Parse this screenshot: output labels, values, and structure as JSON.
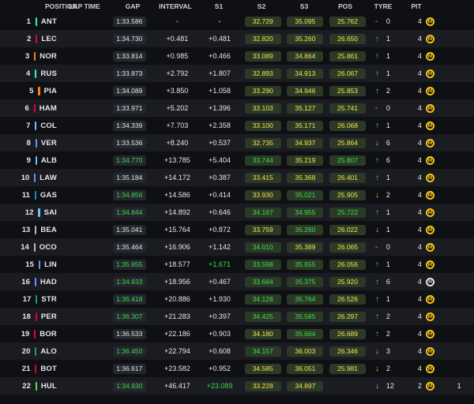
{
  "headers": {
    "position": "POSITION",
    "lap_time": "LAP TIME",
    "gap": "GAP",
    "interval": "INTERVAL",
    "s1": "S1",
    "s2": "S2",
    "s3": "S3",
    "pos": "POS",
    "tyre": "TYRE",
    "pit": "PIT"
  },
  "team_colors": {
    "mercedes": "#27f4d2",
    "ferrari": "#e8002d",
    "mclaren": "#ff8000",
    "redbull": "#3671c6",
    "williams": "#64c4ff",
    "alpine": "#0093cc",
    "racingbulls": "#6692ff",
    "haas": "#b6babd",
    "sauber": "#52e252",
    "astonmartin": "#229971"
  },
  "rows": [
    {
      "pos": "1",
      "code": "ANT",
      "team": "mercedes",
      "lap": "1:33.586",
      "lap_c": "white",
      "gap": "-",
      "int": "-",
      "int_c": "white",
      "s1": "32.729",
      "s1_c": "yellow",
      "s2": "35.095",
      "s2_c": "yellow",
      "s3": "25.762",
      "s3_c": "yellow",
      "chg": "none",
      "chg_n": "0",
      "tyre_age": "4",
      "tyre": "M",
      "pit": ""
    },
    {
      "pos": "2",
      "code": "LEC",
      "team": "ferrari",
      "lap": "1:34.730",
      "lap_c": "white",
      "gap": "+0.481",
      "int": "+0.481",
      "int_c": "white",
      "s1": "32.820",
      "s1_c": "yellow",
      "s2": "35.260",
      "s2_c": "yellow",
      "s3": "26.650",
      "s3_c": "yellow",
      "chg": "up",
      "chg_n": "1",
      "tyre_age": "4",
      "tyre": "M",
      "pit": ""
    },
    {
      "pos": "3",
      "code": "NOR",
      "team": "mclaren",
      "lap": "1:33.814",
      "lap_c": "white",
      "gap": "+0.985",
      "int": "+0.466",
      "int_c": "white",
      "s1": "33.089",
      "s1_c": "yellow",
      "s2": "34.864",
      "s2_c": "yellow",
      "s3": "25.861",
      "s3_c": "yellow",
      "chg": "up",
      "chg_n": "1",
      "tyre_age": "4",
      "tyre": "M",
      "pit": ""
    },
    {
      "pos": "4",
      "code": "RUS",
      "team": "mercedes",
      "lap": "1:33.873",
      "lap_c": "white",
      "gap": "+2.792",
      "int": "+1.807",
      "int_c": "white",
      "s1": "32.893",
      "s1_c": "yellow",
      "s2": "34.913",
      "s2_c": "yellow",
      "s3": "26.067",
      "s3_c": "yellow",
      "chg": "up",
      "chg_n": "1",
      "tyre_age": "4",
      "tyre": "M",
      "pit": ""
    },
    {
      "pos": "5",
      "code": "PIA",
      "team": "mclaren",
      "lap": "1:34.089",
      "lap_c": "white",
      "gap": "+3.850",
      "int": "+1.058",
      "int_c": "white",
      "s1": "33.290",
      "s1_c": "yellow",
      "s2": "34.946",
      "s2_c": "yellow",
      "s3": "25.853",
      "s3_c": "yellow",
      "chg": "up",
      "chg_n": "2",
      "tyre_age": "4",
      "tyre": "M",
      "pit": ""
    },
    {
      "pos": "6",
      "code": "HAM",
      "team": "ferrari",
      "lap": "1:33.971",
      "lap_c": "white",
      "gap": "+5.202",
      "int": "+1.396",
      "int_c": "white",
      "s1": "33.103",
      "s1_c": "yellow",
      "s2": "35.127",
      "s2_c": "yellow",
      "s3": "25.741",
      "s3_c": "yellow",
      "chg": "none",
      "chg_n": "0",
      "tyre_age": "4",
      "tyre": "M",
      "pit": ""
    },
    {
      "pos": "7",
      "code": "COL",
      "team": "williams",
      "lap": "1:34.339",
      "lap_c": "white",
      "gap": "+7.703",
      "int": "+2.358",
      "int_c": "white",
      "s1": "33.100",
      "s1_c": "yellow",
      "s2": "35.171",
      "s2_c": "yellow",
      "s3": "26.068",
      "s3_c": "yellow",
      "chg": "up",
      "chg_n": "1",
      "tyre_age": "4",
      "tyre": "M",
      "pit": ""
    },
    {
      "pos": "8",
      "code": "VER",
      "team": "racingbulls",
      "lap": "1:33.536",
      "lap_c": "white",
      "gap": "+8.240",
      "int": "+0.537",
      "int_c": "white",
      "s1": "32.735",
      "s1_c": "yellow",
      "s2": "34.937",
      "s2_c": "yellow",
      "s3": "25.864",
      "s3_c": "yellow",
      "chg": "down",
      "chg_n": "6",
      "tyre_age": "4",
      "tyre": "M",
      "pit": ""
    },
    {
      "pos": "9",
      "code": "ALB",
      "team": "williams",
      "lap": "1:34.770",
      "lap_c": "green",
      "gap": "+13.785",
      "int": "+5.404",
      "int_c": "white",
      "s1": "33.744",
      "s1_c": "green",
      "s2": "35.219",
      "s2_c": "yellow",
      "s3": "25.807",
      "s3_c": "green",
      "chg": "up",
      "chg_n": "6",
      "tyre_age": "4",
      "tyre": "M",
      "pit": ""
    },
    {
      "pos": "10",
      "code": "LAW",
      "team": "racingbulls",
      "lap": "1:35.184",
      "lap_c": "white",
      "gap": "+14.172",
      "int": "+0.387",
      "int_c": "white",
      "s1": "33.415",
      "s1_c": "yellow",
      "s2": "35.368",
      "s2_c": "yellow",
      "s3": "26.401",
      "s3_c": "yellow",
      "chg": "up",
      "chg_n": "1",
      "tyre_age": "4",
      "tyre": "M",
      "pit": ""
    },
    {
      "pos": "11",
      "code": "GAS",
      "team": "alpine",
      "lap": "1:34.856",
      "lap_c": "green",
      "gap": "+14.586",
      "int": "+0.414",
      "int_c": "white",
      "s1": "33.930",
      "s1_c": "yellow",
      "s2": "35.021",
      "s2_c": "green",
      "s3": "25.905",
      "s3_c": "yellow",
      "chg": "down",
      "chg_n": "2",
      "tyre_age": "4",
      "tyre": "M",
      "pit": ""
    },
    {
      "pos": "12",
      "code": "SAI",
      "team": "williams",
      "lap": "1:34.844",
      "lap_c": "green",
      "gap": "+14.892",
      "int": "+0.646",
      "int_c": "white",
      "s1": "34.167",
      "s1_c": "green",
      "s2": "34.955",
      "s2_c": "green",
      "s3": "25.722",
      "s3_c": "green",
      "chg": "up",
      "chg_n": "1",
      "tyre_age": "4",
      "tyre": "M",
      "pit": ""
    },
    {
      "pos": "13",
      "code": "BEA",
      "team": "haas",
      "lap": "1:35.041",
      "lap_c": "white",
      "gap": "+15.764",
      "int": "+0.872",
      "int_c": "white",
      "s1": "33.759",
      "s1_c": "yellow",
      "s2": "35.260",
      "s2_c": "green",
      "s3": "26.022",
      "s3_c": "yellow",
      "chg": "down",
      "chg_n": "1",
      "tyre_age": "4",
      "tyre": "M",
      "pit": ""
    },
    {
      "pos": "14",
      "code": "OCO",
      "team": "haas",
      "lap": "1:35.464",
      "lap_c": "white",
      "gap": "+16.906",
      "int": "+1.142",
      "int_c": "white",
      "s1": "34.010",
      "s1_c": "green",
      "s2": "35.389",
      "s2_c": "yellow",
      "s3": "26.065",
      "s3_c": "yellow",
      "chg": "none",
      "chg_n": "0",
      "tyre_age": "4",
      "tyre": "M",
      "pit": ""
    },
    {
      "pos": "15",
      "code": "LIN",
      "team": "racingbulls",
      "lap": "1:35.655",
      "lap_c": "green",
      "gap": "+18.577",
      "int": "+1.671",
      "int_c": "green",
      "s1": "33.598",
      "s1_c": "green",
      "s2": "35.655",
      "s2_c": "green",
      "s3": "26.056",
      "s3_c": "yellow",
      "chg": "up",
      "chg_n": "1",
      "tyre_age": "4",
      "tyre": "M",
      "pit": ""
    },
    {
      "pos": "16",
      "code": "HAD",
      "team": "racingbulls",
      "lap": "1:34.833",
      "lap_c": "green",
      "gap": "+18.956",
      "int": "+0.467",
      "int_c": "white",
      "s1": "33.684",
      "s1_c": "green",
      "s2": "35.375",
      "s2_c": "green",
      "s3": "25.920",
      "s3_c": "yellow",
      "chg": "up",
      "chg_n": "6",
      "tyre_age": "4",
      "tyre": "H",
      "pit": ""
    },
    {
      "pos": "17",
      "code": "STR",
      "team": "astonmartin",
      "lap": "1:36.418",
      "lap_c": "green",
      "gap": "+20.886",
      "int": "+1.930",
      "int_c": "white",
      "s1": "34.128",
      "s1_c": "green",
      "s2": "35.764",
      "s2_c": "green",
      "s3": "26.526",
      "s3_c": "yellow",
      "chg": "up",
      "chg_n": "1",
      "tyre_age": "4",
      "tyre": "M",
      "pit": ""
    },
    {
      "pos": "18",
      "code": "PER",
      "team": "ferrari",
      "lap": "1:36.307",
      "lap_c": "green",
      "gap": "+21.283",
      "int": "+0.397",
      "int_c": "white",
      "s1": "34.425",
      "s1_c": "green",
      "s2": "35.585",
      "s2_c": "green",
      "s3": "26.297",
      "s3_c": "yellow",
      "chg": "up",
      "chg_n": "2",
      "tyre_age": "4",
      "tyre": "M",
      "pit": ""
    },
    {
      "pos": "19",
      "code": "BOR",
      "team": "ferrari",
      "lap": "1:36.533",
      "lap_c": "white",
      "gap": "+22.186",
      "int": "+0.903",
      "int_c": "white",
      "s1": "34.180",
      "s1_c": "yellow",
      "s2": "35.664",
      "s2_c": "green",
      "s3": "26.689",
      "s3_c": "yellow",
      "chg": "up",
      "chg_n": "2",
      "tyre_age": "4",
      "tyre": "M",
      "pit": ""
    },
    {
      "pos": "20",
      "code": "ALO",
      "team": "astonmartin",
      "lap": "1:36.450",
      "lap_c": "green",
      "gap": "+22.794",
      "int": "+0.608",
      "int_c": "white",
      "s1": "34.157",
      "s1_c": "green",
      "s2": "36.003",
      "s2_c": "yellow",
      "s3": "26.346",
      "s3_c": "yellow",
      "chg": "down",
      "chg_n": "3",
      "tyre_age": "4",
      "tyre": "M",
      "pit": ""
    },
    {
      "pos": "21",
      "code": "BOT",
      "team": "ferrari",
      "lap": "1:36.617",
      "lap_c": "white",
      "gap": "+23.582",
      "int": "+0.952",
      "int_c": "white",
      "s1": "34.585",
      "s1_c": "yellow",
      "s2": "36.051",
      "s2_c": "yellow",
      "s3": "25.981",
      "s3_c": "yellow",
      "chg": "down",
      "chg_n": "2",
      "tyre_age": "4",
      "tyre": "M",
      "pit": ""
    },
    {
      "pos": "22",
      "code": "HUL",
      "team": "sauber",
      "lap": "1:34.930",
      "lap_c": "green",
      "gap": "+46.417",
      "int": "+23.089",
      "int_c": "green",
      "s1": "33.228",
      "s1_c": "yellow",
      "s2": "34.897",
      "s2_c": "yellow",
      "s3": "",
      "s3_c": "yellow",
      "chg": "down",
      "chg_n": "12",
      "tyre_age": "2",
      "tyre": "M",
      "pit": "1"
    }
  ]
}
